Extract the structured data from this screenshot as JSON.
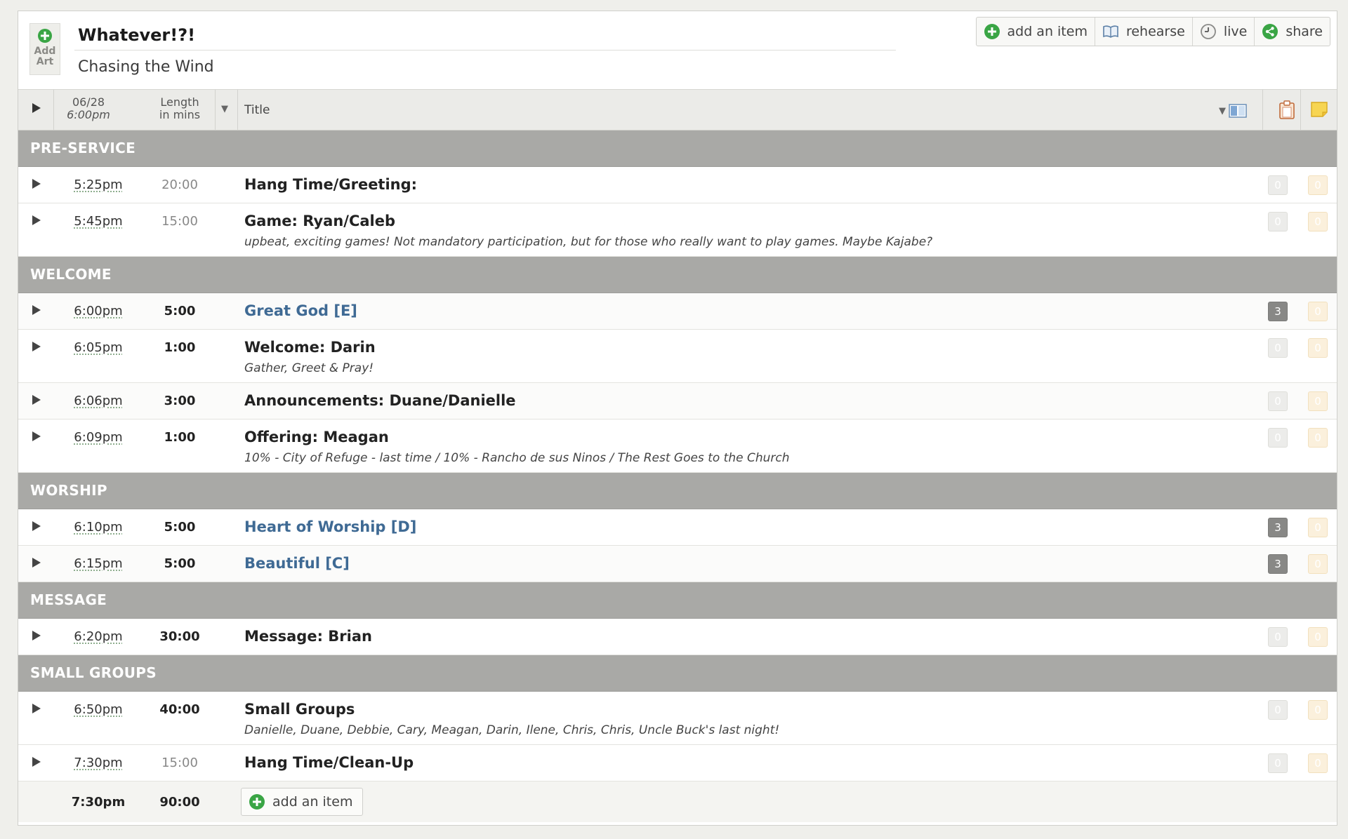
{
  "header": {
    "add_art_label_1": "Add",
    "add_art_label_2": "Art",
    "title": "Whatever!?!",
    "subtitle": "Chasing the Wind"
  },
  "toolbar": {
    "add_item": "add an item",
    "rehearse": "rehearse",
    "live": "live",
    "share": "share"
  },
  "columns": {
    "date": "06/28",
    "start_time": "6:00pm",
    "length_1": "Length",
    "length_2": "in mins",
    "title": "Title"
  },
  "sections": {
    "preservice": "PRE-SERVICE",
    "welcome": "WELCOME",
    "worship": "WORSHIP",
    "message": "MESSAGE",
    "small_groups": "SMALL GROUPS"
  },
  "items": [
    {
      "time": "5:25pm",
      "length": "20:00",
      "title": "Hang Time/Greeting:",
      "note": "",
      "a": "0",
      "b": "0"
    },
    {
      "time": "5:45pm",
      "length": "15:00",
      "title": "Game: Ryan/Caleb",
      "note": "upbeat, exciting games! Not mandatory participation, but for those who really want to play games. Maybe Kajabe?",
      "a": "0",
      "b": "0"
    },
    {
      "time": "6:00pm",
      "length": "5:00",
      "title": "Great God [E]",
      "note": "",
      "a": "3",
      "b": "0"
    },
    {
      "time": "6:05pm",
      "length": "1:00",
      "title": "Welcome: Darin",
      "note": "Gather, Greet & Pray!",
      "a": "0",
      "b": "0"
    },
    {
      "time": "6:06pm",
      "length": "3:00",
      "title": "Announcements: Duane/Danielle",
      "note": "",
      "a": "0",
      "b": "0"
    },
    {
      "time": "6:09pm",
      "length": "1:00",
      "title": "Offering: Meagan",
      "note": "10% - City of Refuge - last time / 10% - Rancho de sus Ninos / The Rest Goes to the Church",
      "a": "0",
      "b": "0"
    },
    {
      "time": "6:10pm",
      "length": "5:00",
      "title": "Heart of Worship [D]",
      "note": "",
      "a": "3",
      "b": "0"
    },
    {
      "time": "6:15pm",
      "length": "5:00",
      "title": "Beautiful [C]",
      "note": "",
      "a": "3",
      "b": "0"
    },
    {
      "time": "6:20pm",
      "length": "30:00",
      "title": "Message: Brian",
      "note": "",
      "a": "0",
      "b": "0"
    },
    {
      "time": "6:50pm",
      "length": "40:00",
      "title": "Small Groups",
      "note": "Danielle, Duane, Debbie, Cary, Meagan, Darin, Ilene, Chris, Chris, Uncle Buck's last night!",
      "a": "0",
      "b": "0"
    },
    {
      "time": "7:30pm",
      "length": "15:00",
      "title": "Hang Time/Clean-Up",
      "note": "",
      "a": "0",
      "b": "0"
    }
  ],
  "footer": {
    "end_time": "7:30pm",
    "total_length": "90:00",
    "add_item": "add an item"
  },
  "icons": {
    "add": "plus-circle-icon",
    "rehearse": "book-icon",
    "live": "clock-icon",
    "share": "share-icon",
    "play": "play-icon",
    "columns": "columns-icon",
    "attachments": "clipboard-icon",
    "notes": "note-icon"
  },
  "colors": {
    "accent_green": "#3aa545",
    "section_bar": "#a9a9a6",
    "song_title": "#3f6a94"
  }
}
